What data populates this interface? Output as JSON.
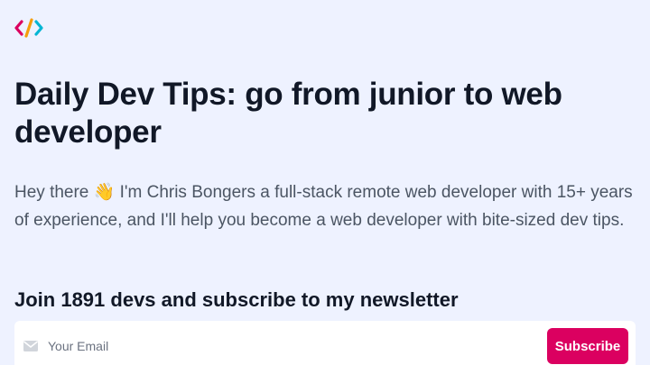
{
  "logo": {
    "icon": "code-bracket-logo-icon"
  },
  "hero": {
    "title": "Daily Dev Tips: go from junior to web developer",
    "intro": "Hey there 👋 I'm Chris Bongers a full-stack remote web developer with 15+ years of experience, and I'll help you become a web developer with bite-sized dev tips."
  },
  "newsletter": {
    "heading": "Join 1891 devs and subscribe to my newsletter",
    "email_placeholder": "Your Email",
    "email_value": "",
    "mail_icon": "envelope-icon",
    "subscribe_label": "Subscribe"
  },
  "colors": {
    "background": "#eef2ff",
    "accent": "#db0060",
    "title": "#111827",
    "body_text": "#4b5563"
  }
}
